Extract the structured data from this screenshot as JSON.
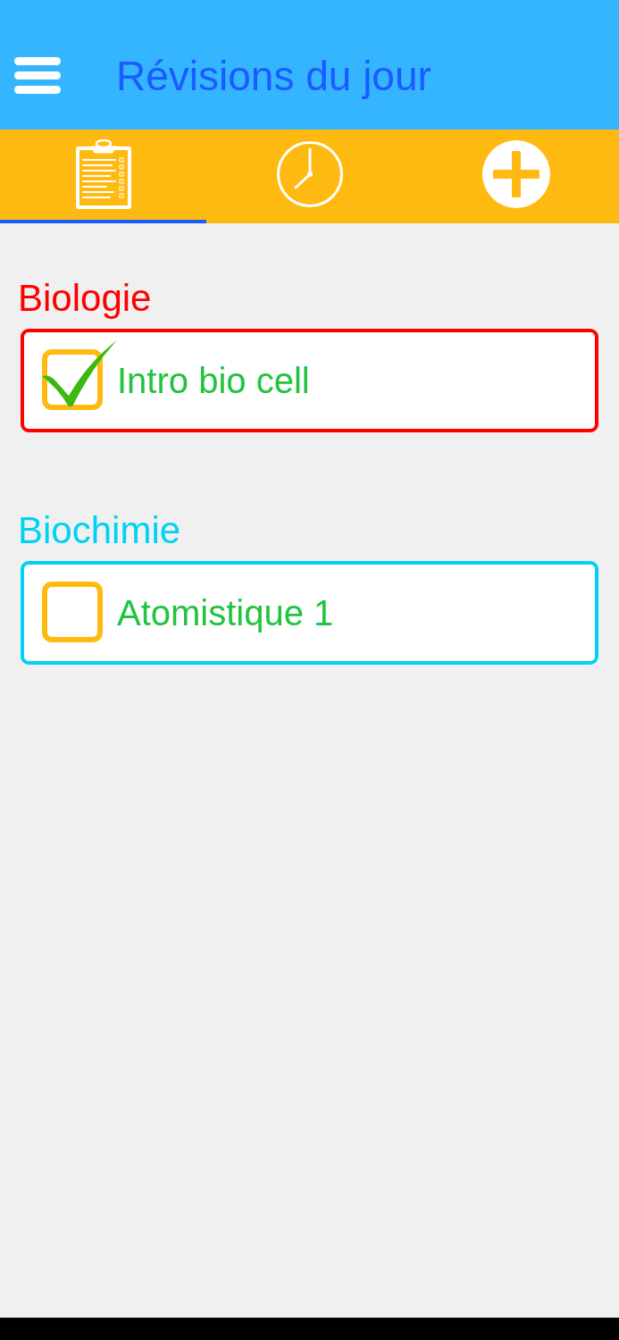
{
  "app_bar": {
    "title": "Révisions du jour"
  },
  "tabs": [
    {
      "kind": "clipboard",
      "selected": true
    },
    {
      "kind": "clock",
      "selected": false
    },
    {
      "kind": "add",
      "selected": false
    }
  ],
  "sections": [
    {
      "title": "Biologie",
      "color": "#ff0000",
      "items": [
        {
          "label": "Intro bio cell",
          "checked": true
        }
      ]
    },
    {
      "title": "Biochimie",
      "color": "#00d2f5",
      "items": [
        {
          "label": "Atomistique 1",
          "checked": false
        }
      ]
    }
  ]
}
